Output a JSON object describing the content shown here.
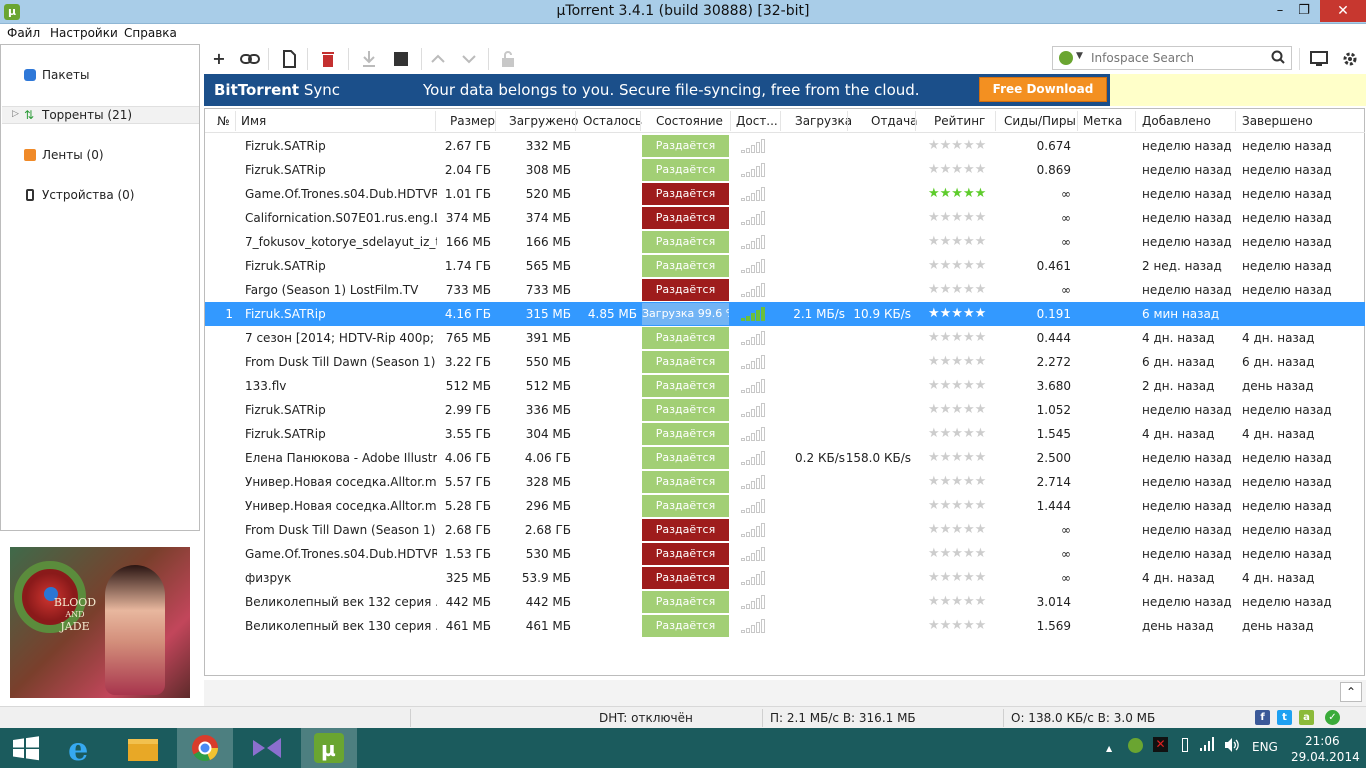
{
  "window": {
    "title": "µTorrent 3.4.1  (build 30888) [32-bit]",
    "app_icon": "µ",
    "min": "–",
    "max": "❐",
    "close": "✕"
  },
  "menu": [
    "Файл",
    "Настройки",
    "Справка"
  ],
  "toolbar": {
    "icons": [
      "add-torrent-icon",
      "add-link-icon",
      "create-torrent-icon",
      "remove-icon",
      "start-icon",
      "stop-icon",
      "move-up-icon",
      "move-down-icon",
      "unlock-icon",
      "remote-icon",
      "settings-icon"
    ]
  },
  "search": {
    "placeholder": "Infospace Search"
  },
  "sidebar": {
    "items": [
      {
        "label": "Пакеты"
      },
      {
        "label": "Торренты (21)"
      },
      {
        "label": "Ленты (0)"
      },
      {
        "label": "Устройства (0)"
      }
    ]
  },
  "ad": {
    "title_line1": "BLOOD",
    "title_line2": "AND",
    "title_line3": "JADE"
  },
  "banner": {
    "brand": "BitTorrent",
    "brand_suffix": " Sync",
    "text": "Your data belongs to you.  Secure file-syncing, free from the cloud.",
    "button": "Free Download"
  },
  "columns": [
    "№",
    "Имя",
    "Размер",
    "Загружено",
    "Осталось",
    "Состояние",
    "Дост...",
    "Загрузка",
    "Отдача",
    "Рейтинг",
    "Сиды/Пиры",
    "Метка",
    "Добавлено",
    "Завершено"
  ],
  "rows": [
    {
      "num": "",
      "name": "Fizruk.SATRip",
      "size": "2.67 ГБ",
      "done": "332 МБ",
      "left": "",
      "state": "Раздаётся",
      "kind": "seed",
      "down": "",
      "up": "",
      "green": false,
      "ratio": "0.674",
      "added": "неделю назад",
      "finished": "неделю назад"
    },
    {
      "num": "",
      "name": "Fizruk.SATRip",
      "size": "2.04 ГБ",
      "done": "308 МБ",
      "left": "",
      "state": "Раздаётся",
      "kind": "seed",
      "down": "",
      "up": "",
      "green": false,
      "ratio": "0.869",
      "added": "неделю назад",
      "finished": "неделю назад"
    },
    {
      "num": "",
      "name": "Game.Of.Trones.s04.Dub.HDTVRip",
      "size": "1.01 ГБ",
      "done": "520 МБ",
      "left": "",
      "state": "Раздаётся",
      "kind": "seedr",
      "down": "",
      "up": "",
      "green": true,
      "ratio": "∞",
      "added": "неделю назад",
      "finished": "неделю назад"
    },
    {
      "num": "",
      "name": "Californication.S07E01.rus.eng.Los...",
      "size": "374 МБ",
      "done": "374 МБ",
      "left": "",
      "state": "Раздаётся",
      "kind": "seedr",
      "down": "",
      "up": "",
      "green": false,
      "ratio": "∞",
      "added": "неделю назад",
      "finished": "неделю назад"
    },
    {
      "num": "",
      "name": "7_fokusov_kotorye_sdelayut_iz_teb...",
      "size": "166 МБ",
      "done": "166 МБ",
      "left": "",
      "state": "Раздаётся",
      "kind": "seed",
      "down": "",
      "up": "",
      "green": false,
      "ratio": "∞",
      "added": "неделю назад",
      "finished": "неделю назад"
    },
    {
      "num": "",
      "name": "Fizruk.SATRip",
      "size": "1.74 ГБ",
      "done": "565 МБ",
      "left": "",
      "state": "Раздаётся",
      "kind": "seed",
      "down": "",
      "up": "",
      "green": false,
      "ratio": "0.461",
      "added": "2 нед. назад",
      "finished": "неделю назад"
    },
    {
      "num": "",
      "name": "Fargo (Season 1) LostFilm.TV",
      "size": "733 МБ",
      "done": "733 МБ",
      "left": "",
      "state": "Раздаётся",
      "kind": "seedr",
      "down": "",
      "up": "",
      "green": false,
      "ratio": "∞",
      "added": "неделю назад",
      "finished": "неделю назад"
    },
    {
      "num": "1",
      "name": "Fizruk.SATRip",
      "size": "4.16 ГБ",
      "done": "315 МБ",
      "left": "4.85 МБ",
      "state": "Загрузка 99.6 %",
      "kind": "dl",
      "down": "2.1 МБ/s",
      "up": "10.9 КБ/s",
      "green": false,
      "ratio": "0.191",
      "added": "6 мин назад",
      "finished": "",
      "selected": true
    },
    {
      "num": "",
      "name": "7 сезон [2014; HDTV-Rip 400p; Los...",
      "size": "765 МБ",
      "done": "391 МБ",
      "left": "",
      "state": "Раздаётся",
      "kind": "seed",
      "down": "",
      "up": "",
      "green": false,
      "ratio": "0.444",
      "added": "4 дн. назад",
      "finished": "4 дн. назад"
    },
    {
      "num": "",
      "name": "From Dusk Till Dawn (Season 1) N...",
      "size": "3.22 ГБ",
      "done": "550 МБ",
      "left": "",
      "state": "Раздаётся",
      "kind": "seed",
      "down": "",
      "up": "",
      "green": false,
      "ratio": "2.272",
      "added": "6 дн. назад",
      "finished": "6 дн. назад"
    },
    {
      "num": "",
      "name": "133.flv",
      "size": "512 МБ",
      "done": "512 МБ",
      "left": "",
      "state": "Раздаётся",
      "kind": "seed",
      "down": "",
      "up": "",
      "green": false,
      "ratio": "3.680",
      "added": "2 дн. назад",
      "finished": "день назад"
    },
    {
      "num": "",
      "name": "Fizruk.SATRip",
      "size": "2.99 ГБ",
      "done": "336 МБ",
      "left": "",
      "state": "Раздаётся",
      "kind": "seed",
      "down": "",
      "up": "",
      "green": false,
      "ratio": "1.052",
      "added": "неделю назад",
      "finished": "неделю назад"
    },
    {
      "num": "",
      "name": "Fizruk.SATRip",
      "size": "3.55 ГБ",
      "done": "304 МБ",
      "left": "",
      "state": "Раздаётся",
      "kind": "seed",
      "down": "",
      "up": "",
      "green": false,
      "ratio": "1.545",
      "added": "4 дн. назад",
      "finished": "4 дн. назад"
    },
    {
      "num": "",
      "name": "Елена Панюкова - Adobe Illustrat...",
      "size": "4.06 ГБ",
      "done": "4.06 ГБ",
      "left": "",
      "state": "Раздаётся",
      "kind": "seed",
      "down": "0.2 КБ/s",
      "up": "158.0 КБ/s",
      "green": false,
      "ratio": "2.500",
      "added": "неделю назад",
      "finished": "неделю назад"
    },
    {
      "num": "",
      "name": "Универ.Новая соседка.Alltor.me.J...",
      "size": "5.57 ГБ",
      "done": "328 МБ",
      "left": "",
      "state": "Раздаётся",
      "kind": "seed",
      "down": "",
      "up": "",
      "green": false,
      "ratio": "2.714",
      "added": "неделю назад",
      "finished": "неделю назад"
    },
    {
      "num": "",
      "name": "Универ.Новая соседка.Alltor.me.J...",
      "size": "5.28 ГБ",
      "done": "296 МБ",
      "left": "",
      "state": "Раздаётся",
      "kind": "seed",
      "down": "",
      "up": "",
      "green": false,
      "ratio": "1.444",
      "added": "неделю назад",
      "finished": "неделю назад"
    },
    {
      "num": "",
      "name": "From Dusk Till Dawn (Season 1) N...",
      "size": "2.68 ГБ",
      "done": "2.68 ГБ",
      "left": "",
      "state": "Раздаётся",
      "kind": "seedr",
      "down": "",
      "up": "",
      "green": false,
      "ratio": "∞",
      "added": "неделю назад",
      "finished": "неделю назад"
    },
    {
      "num": "",
      "name": "Game.Of.Trones.s04.Dub.HDTVRip",
      "size": "1.53 ГБ",
      "done": "530 МБ",
      "left": "",
      "state": "Раздаётся",
      "kind": "seedr",
      "down": "",
      "up": "",
      "green": false,
      "ratio": "∞",
      "added": "неделю назад",
      "finished": "неделю назад"
    },
    {
      "num": "",
      "name": "физрук",
      "size": "325 МБ",
      "done": "53.9 МБ",
      "left": "",
      "state": "Раздаётся",
      "kind": "seedr",
      "down": "",
      "up": "",
      "green": false,
      "ratio": "∞",
      "added": "4 дн. назад",
      "finished": "4 дн. назад"
    },
    {
      "num": "",
      "name": "Великолепный век 132 серия .All...",
      "size": "442 МБ",
      "done": "442 МБ",
      "left": "",
      "state": "Раздаётся",
      "kind": "seed",
      "down": "",
      "up": "",
      "green": false,
      "ratio": "3.014",
      "added": "неделю назад",
      "finished": "неделю назад"
    },
    {
      "num": "",
      "name": "Великолепный век 130 серия .All...",
      "size": "461 МБ",
      "done": "461 МБ",
      "left": "",
      "state": "Раздаётся",
      "kind": "seed",
      "down": "",
      "up": "",
      "green": false,
      "ratio": "1.569",
      "added": "день назад",
      "finished": "день назад"
    }
  ],
  "status": {
    "dht": "DHT: отключён",
    "down": "П: 2.1 МБ/с В: 316.1 МБ",
    "up": "О: 138.0 КБ/с В: 3.0 МБ"
  },
  "taskbar": {
    "lang": "ENG",
    "time": "21:06",
    "date": "29.04.2014"
  }
}
